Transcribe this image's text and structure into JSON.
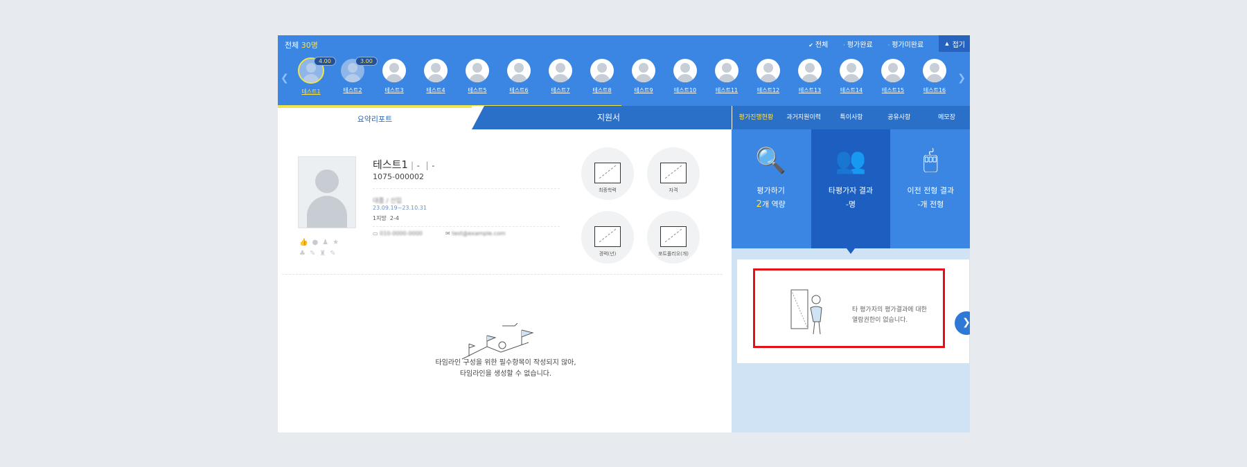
{
  "header": {
    "total_label": "전체",
    "total_count": "30명",
    "filters": [
      "전체",
      "평가완료",
      "평가미완료"
    ],
    "fold_label": "접기"
  },
  "people": [
    {
      "name": "테스트1",
      "score": "4.00"
    },
    {
      "name": "테스트2",
      "score": "3.00"
    },
    {
      "name": "테스트3"
    },
    {
      "name": "테스트4"
    },
    {
      "name": "테스트5"
    },
    {
      "name": "테스트6"
    },
    {
      "name": "테스트7"
    },
    {
      "name": "테스트8"
    },
    {
      "name": "테스트9"
    },
    {
      "name": "테스트10"
    },
    {
      "name": "테스트11"
    },
    {
      "name": "테스트12"
    },
    {
      "name": "테스트13"
    },
    {
      "name": "테스트14"
    },
    {
      "name": "테스트15"
    },
    {
      "name": "테스트16"
    }
  ],
  "tabs": {
    "summary": "요약리포트",
    "application": "지원서",
    "right": [
      "평가진행현황",
      "과거지원이력",
      "특이사항",
      "공유사항",
      "메모장"
    ]
  },
  "profile": {
    "name": "테스트1",
    "sep1": "-",
    "sep2": "-",
    "code": "1075-000002",
    "blurred_info": "대졸 / 신입",
    "date_range": "23.09.19~23.10.31",
    "rank": "1지망",
    "rank_value": "2-4",
    "phone": "010-0000-0000",
    "email": "test@example.com"
  },
  "doc_buttons": [
    "최종학력",
    "자격",
    "경력(년)",
    "포트폴리오(개)"
  ],
  "timeline_message": [
    "타임라인 구성을 위한 필수항목이 작성되지 않아,",
    "타임라인을 생성할 수 없습니다."
  ],
  "eval_cards": [
    {
      "title": "평가하기",
      "value": "2",
      "unit": "개 역량"
    },
    {
      "title": "타평가자 결과",
      "value": "",
      "unit": "-명"
    },
    {
      "title": "이전 전형 결과",
      "value": "",
      "unit": "-개 전형"
    }
  ],
  "no_permission": [
    "타 평가자의 평가결과에 대한",
    "열람권한이 없습니다."
  ],
  "colors": {
    "primary": "#3a86e2",
    "accent": "#ffe14a",
    "alert": "#e30f19"
  }
}
